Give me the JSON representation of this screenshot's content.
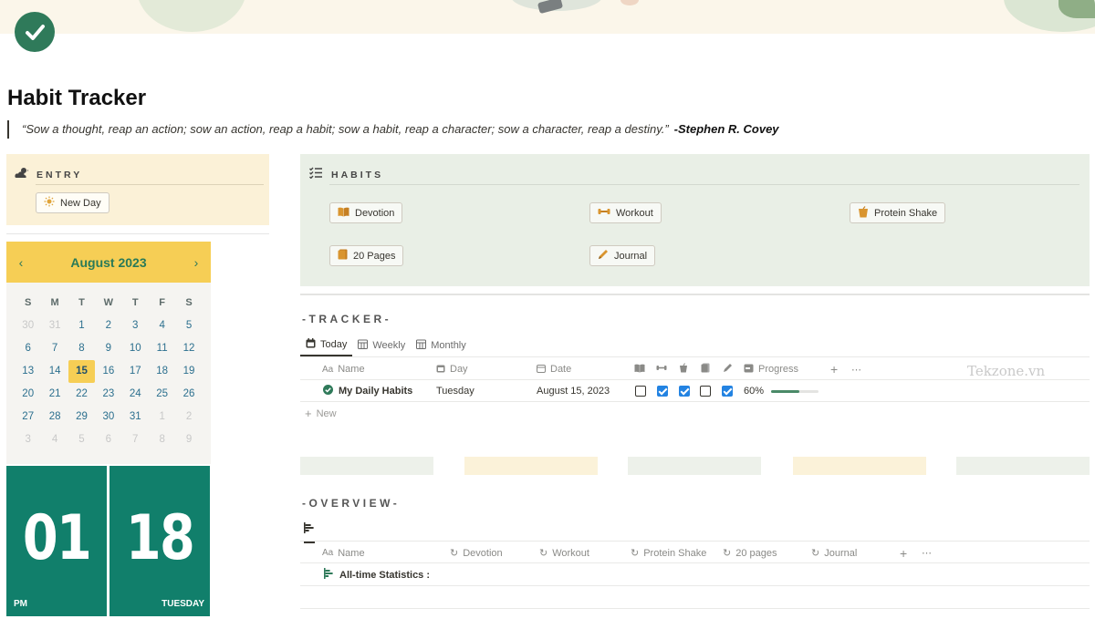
{
  "page": {
    "title": "Habit Tracker",
    "quote": "“Sow a thought, reap an action; sow an action, reap a habit; sow a habit, reap a character; sow a character, reap a destiny.”",
    "quote_author": "-Stephen R. Covey"
  },
  "entry": {
    "heading": "ENTRY",
    "button": "New Day"
  },
  "calendar": {
    "month": "August 2023",
    "weekdays": [
      "S",
      "M",
      "T",
      "W",
      "T",
      "F",
      "S"
    ],
    "weeks": [
      [
        "30",
        "31",
        "1",
        "2",
        "3",
        "4",
        "5"
      ],
      [
        "6",
        "7",
        "8",
        "9",
        "10",
        "11",
        "12"
      ],
      [
        "13",
        "14",
        "15",
        "16",
        "17",
        "18",
        "19"
      ],
      [
        "20",
        "21",
        "22",
        "23",
        "24",
        "25",
        "26"
      ],
      [
        "27",
        "28",
        "29",
        "30",
        "31",
        "1",
        "2"
      ],
      [
        "3",
        "4",
        "5",
        "6",
        "7",
        "8",
        "9"
      ]
    ],
    "today": "15"
  },
  "clock": {
    "hour": "01",
    "minute": "18",
    "ampm": "PM",
    "weekday": "TUESDAY"
  },
  "habits": {
    "heading": "HABITS",
    "items": [
      "Devotion",
      "Workout",
      "Protein Shake",
      "20 Pages",
      "Journal"
    ]
  },
  "tracker": {
    "title": "-TRACKER-",
    "tabs": [
      "Today",
      "Weekly",
      "Monthly"
    ],
    "columns": {
      "name": "Name",
      "day": "Day",
      "date": "Date",
      "progress": "Progress"
    },
    "name_prefix": "Aa",
    "row": {
      "name": "My Daily Habits",
      "day": "Tuesday",
      "date": "August 15, 2023",
      "checks": [
        false,
        true,
        true,
        false,
        true
      ],
      "progress_label": "60%",
      "progress": 0.6
    },
    "new_label": "New"
  },
  "watermark": "Tekzone.vn",
  "swatch_colors": [
    "#edf1ea",
    "#fbf2d9",
    "#edf1ea",
    "#fbf2d9",
    "#edf1ea"
  ],
  "overview": {
    "title": "-OVERVIEW-",
    "columns": [
      "Name",
      "Devotion",
      "Workout",
      "Protein Shake",
      "20 pages",
      "Journal"
    ],
    "row_name": "All-time Statistics :"
  },
  "colors": {
    "accent_green": "#117f6b",
    "calendar_yellow": "#f6ce55",
    "checkbox_blue": "#2383e2"
  }
}
